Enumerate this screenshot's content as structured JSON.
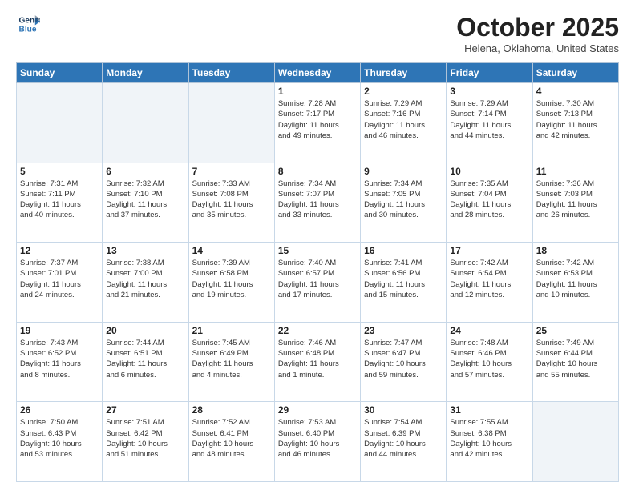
{
  "header": {
    "logo_line1": "General",
    "logo_line2": "Blue",
    "month": "October 2025",
    "location": "Helena, Oklahoma, United States"
  },
  "weekdays": [
    "Sunday",
    "Monday",
    "Tuesday",
    "Wednesday",
    "Thursday",
    "Friday",
    "Saturday"
  ],
  "weeks": [
    [
      {
        "day": "",
        "info": ""
      },
      {
        "day": "",
        "info": ""
      },
      {
        "day": "",
        "info": ""
      },
      {
        "day": "1",
        "info": "Sunrise: 7:28 AM\nSunset: 7:17 PM\nDaylight: 11 hours\nand 49 minutes."
      },
      {
        "day": "2",
        "info": "Sunrise: 7:29 AM\nSunset: 7:16 PM\nDaylight: 11 hours\nand 46 minutes."
      },
      {
        "day": "3",
        "info": "Sunrise: 7:29 AM\nSunset: 7:14 PM\nDaylight: 11 hours\nand 44 minutes."
      },
      {
        "day": "4",
        "info": "Sunrise: 7:30 AM\nSunset: 7:13 PM\nDaylight: 11 hours\nand 42 minutes."
      }
    ],
    [
      {
        "day": "5",
        "info": "Sunrise: 7:31 AM\nSunset: 7:11 PM\nDaylight: 11 hours\nand 40 minutes."
      },
      {
        "day": "6",
        "info": "Sunrise: 7:32 AM\nSunset: 7:10 PM\nDaylight: 11 hours\nand 37 minutes."
      },
      {
        "day": "7",
        "info": "Sunrise: 7:33 AM\nSunset: 7:08 PM\nDaylight: 11 hours\nand 35 minutes."
      },
      {
        "day": "8",
        "info": "Sunrise: 7:34 AM\nSunset: 7:07 PM\nDaylight: 11 hours\nand 33 minutes."
      },
      {
        "day": "9",
        "info": "Sunrise: 7:34 AM\nSunset: 7:05 PM\nDaylight: 11 hours\nand 30 minutes."
      },
      {
        "day": "10",
        "info": "Sunrise: 7:35 AM\nSunset: 7:04 PM\nDaylight: 11 hours\nand 28 minutes."
      },
      {
        "day": "11",
        "info": "Sunrise: 7:36 AM\nSunset: 7:03 PM\nDaylight: 11 hours\nand 26 minutes."
      }
    ],
    [
      {
        "day": "12",
        "info": "Sunrise: 7:37 AM\nSunset: 7:01 PM\nDaylight: 11 hours\nand 24 minutes."
      },
      {
        "day": "13",
        "info": "Sunrise: 7:38 AM\nSunset: 7:00 PM\nDaylight: 11 hours\nand 21 minutes."
      },
      {
        "day": "14",
        "info": "Sunrise: 7:39 AM\nSunset: 6:58 PM\nDaylight: 11 hours\nand 19 minutes."
      },
      {
        "day": "15",
        "info": "Sunrise: 7:40 AM\nSunset: 6:57 PM\nDaylight: 11 hours\nand 17 minutes."
      },
      {
        "day": "16",
        "info": "Sunrise: 7:41 AM\nSunset: 6:56 PM\nDaylight: 11 hours\nand 15 minutes."
      },
      {
        "day": "17",
        "info": "Sunrise: 7:42 AM\nSunset: 6:54 PM\nDaylight: 11 hours\nand 12 minutes."
      },
      {
        "day": "18",
        "info": "Sunrise: 7:42 AM\nSunset: 6:53 PM\nDaylight: 11 hours\nand 10 minutes."
      }
    ],
    [
      {
        "day": "19",
        "info": "Sunrise: 7:43 AM\nSunset: 6:52 PM\nDaylight: 11 hours\nand 8 minutes."
      },
      {
        "day": "20",
        "info": "Sunrise: 7:44 AM\nSunset: 6:51 PM\nDaylight: 11 hours\nand 6 minutes."
      },
      {
        "day": "21",
        "info": "Sunrise: 7:45 AM\nSunset: 6:49 PM\nDaylight: 11 hours\nand 4 minutes."
      },
      {
        "day": "22",
        "info": "Sunrise: 7:46 AM\nSunset: 6:48 PM\nDaylight: 11 hours\nand 1 minute."
      },
      {
        "day": "23",
        "info": "Sunrise: 7:47 AM\nSunset: 6:47 PM\nDaylight: 10 hours\nand 59 minutes."
      },
      {
        "day": "24",
        "info": "Sunrise: 7:48 AM\nSunset: 6:46 PM\nDaylight: 10 hours\nand 57 minutes."
      },
      {
        "day": "25",
        "info": "Sunrise: 7:49 AM\nSunset: 6:44 PM\nDaylight: 10 hours\nand 55 minutes."
      }
    ],
    [
      {
        "day": "26",
        "info": "Sunrise: 7:50 AM\nSunset: 6:43 PM\nDaylight: 10 hours\nand 53 minutes."
      },
      {
        "day": "27",
        "info": "Sunrise: 7:51 AM\nSunset: 6:42 PM\nDaylight: 10 hours\nand 51 minutes."
      },
      {
        "day": "28",
        "info": "Sunrise: 7:52 AM\nSunset: 6:41 PM\nDaylight: 10 hours\nand 48 minutes."
      },
      {
        "day": "29",
        "info": "Sunrise: 7:53 AM\nSunset: 6:40 PM\nDaylight: 10 hours\nand 46 minutes."
      },
      {
        "day": "30",
        "info": "Sunrise: 7:54 AM\nSunset: 6:39 PM\nDaylight: 10 hours\nand 44 minutes."
      },
      {
        "day": "31",
        "info": "Sunrise: 7:55 AM\nSunset: 6:38 PM\nDaylight: 10 hours\nand 42 minutes."
      },
      {
        "day": "",
        "info": ""
      }
    ]
  ]
}
